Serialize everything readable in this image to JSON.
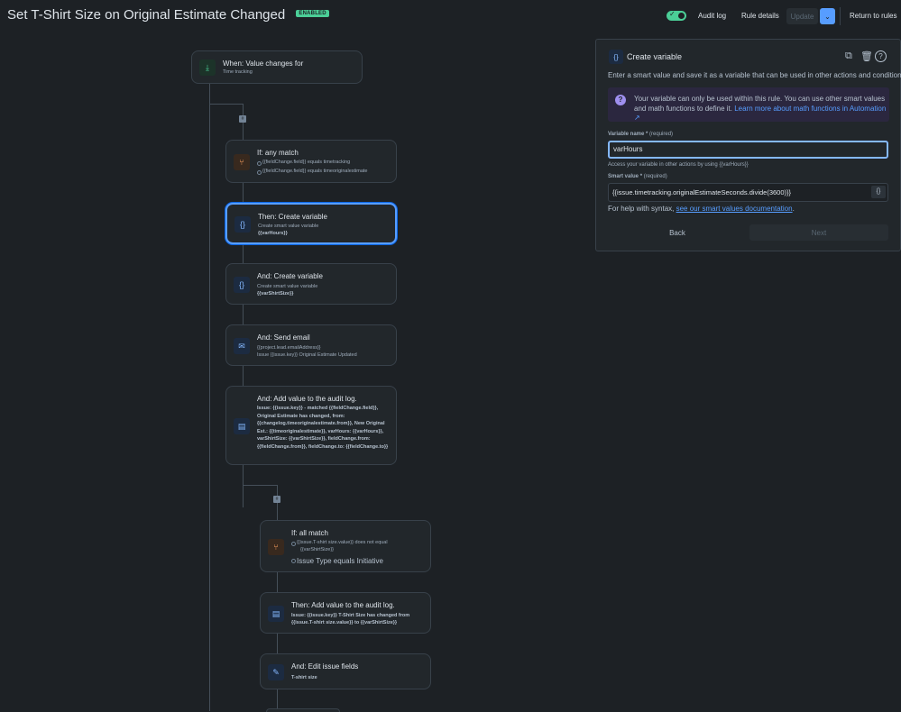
{
  "header": {
    "title": "Set T-Shirt Size on Original Estimate Changed",
    "status_badge": "ENABLED",
    "audit_log": "Audit log",
    "rule_details": "Rule details",
    "update": "Update",
    "return": "Return to rules",
    "toggle_on": true
  },
  "flow": {
    "trigger": {
      "title": "When: Value changes for",
      "sub": "Time tracking"
    },
    "if_any": {
      "title": "If: any match",
      "conds": [
        "{{fieldChange.field}} equals timetracking",
        "{{fieldChange.field}} equals timeoriginalestimate"
      ]
    },
    "create1": {
      "title": "Then: Create variable",
      "sub": "Create smart value variable",
      "var": "{{varHours}}"
    },
    "create2": {
      "title": "And: Create variable",
      "sub": "Create smart value variable",
      "var": "{{varShirtSize}}"
    },
    "email": {
      "title": "And: Send email",
      "line1": "{{project.lead.emailAddress}}",
      "line2": "Issue {{issue.key}} Original Estimate Updated"
    },
    "audit1": {
      "title": "And: Add value to the audit log.",
      "text": "Issue: {{issue.key}} - matched {{fieldChange.field}}, Original Estimate has changed, from: {{changelog.timeoriginalestimate.from}}, New Original Est.: {{timeoriginalestimate}}, varHours: {{varHours}}, varShirtSize: {{varShirtSize}}, fieldChange.from: {{fieldChange.from}}, fieldChange.to: {{fieldChange.to}}"
    },
    "if_all": {
      "title": "If: all match",
      "cond1a": "{{issue.T-shirt size.value}} does not equal",
      "cond1b": "{{varShirtSize}}",
      "cond2": "Issue Type equals Initiative"
    },
    "audit2": {
      "title": "Then: Add value to the audit log.",
      "line1": "Issue: {{issue.key}} T-Shirt Size has changed from",
      "line2": "{{issue.T-shirt size.value}} to {{varShirtSize}}"
    },
    "edit": {
      "title": "And: Edit issue fields",
      "sub": "T-shirt size"
    }
  },
  "panel": {
    "title": "Create variable",
    "description": "Enter a smart value and save it as a variable that can be used in other actions and conditions.",
    "info_text": "Your variable can only be used within this rule. You can use other smart values and math functions to define it.",
    "info_link": "Learn more about math functions in Automation ↗",
    "var_label": "Variable name",
    "required": "(required)",
    "var_value": "varHours",
    "var_hint": "Access your variable in other actions by using {{varHours}}",
    "smart_label": "Smart value",
    "smart_value": "{{issue.timetracking.originalEstimateSeconds.divide(3600)}}",
    "smart_btn": "{}",
    "help_prefix": "For help with syntax,",
    "help_link": "see our smart values documentation",
    "help_suffix": ".",
    "back": "Back",
    "next": "Next"
  }
}
